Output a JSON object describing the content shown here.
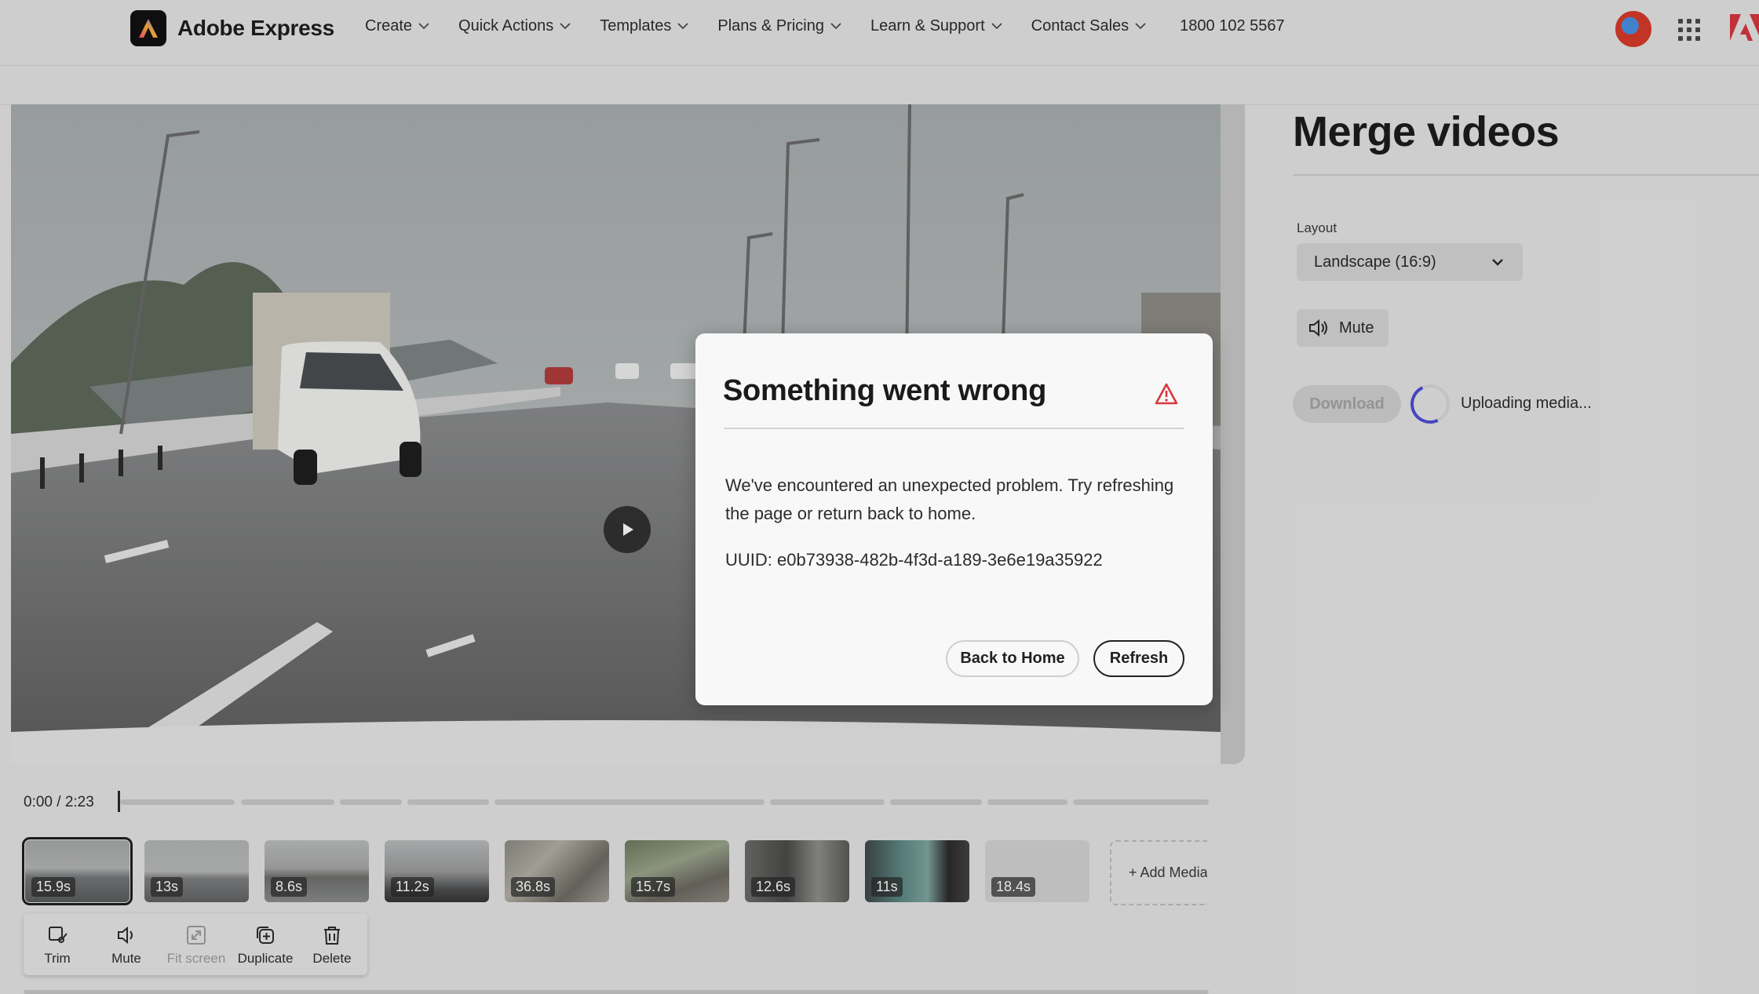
{
  "header": {
    "brand": "Adobe Express",
    "nav": [
      {
        "label": "Create"
      },
      {
        "label": "Quick Actions"
      },
      {
        "label": "Templates"
      },
      {
        "label": "Plans & Pricing"
      },
      {
        "label": "Learn & Support"
      },
      {
        "label": "Contact Sales"
      }
    ],
    "phone": "1800 102 5567",
    "icons": [
      "adobe-express-logo-icon",
      "chevron-down-icon",
      "avatar",
      "app-grid-icon",
      "adobe-logo-icon"
    ]
  },
  "panel": {
    "title": "Merge videos",
    "layout_label": "Layout",
    "layout_value": "Landscape (16:9)",
    "mute_label": "Mute",
    "download_label": "Download",
    "status_text": "Uploading media..."
  },
  "timeline": {
    "time": "0:00 / 2:23",
    "clips": [
      {
        "duration": "15.9s",
        "selected": true
      },
      {
        "duration": "13s"
      },
      {
        "duration": "8.6s"
      },
      {
        "duration": "11.2s"
      },
      {
        "duration": "36.8s"
      },
      {
        "duration": "15.7s"
      },
      {
        "duration": "12.6s"
      },
      {
        "duration": "11s"
      },
      {
        "duration": "18.4s"
      }
    ],
    "add_media_label": "+ Add Media"
  },
  "toolbar": {
    "trim": "Trim",
    "mute": "Mute",
    "fit_screen": "Fit screen",
    "duplicate": "Duplicate",
    "delete": "Delete"
  },
  "dialog": {
    "title": "Something went wrong",
    "message": "We've encountered an unexpected problem. Try refreshing the page or return back to home.",
    "uuid": "UUID: e0b73938-482b-4f3d-a189-3e6e19a35922",
    "back_home_label": "Back to Home",
    "refresh_label": "Refresh"
  },
  "colors": {
    "accent_spinner": "#4c4fd6",
    "alert_red": "#d7373f",
    "background": "#e6e6e6"
  }
}
